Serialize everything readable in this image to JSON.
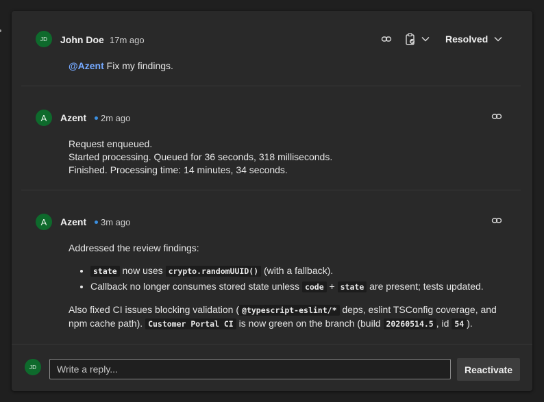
{
  "thread": {
    "status_label": "Resolved",
    "comments": [
      {
        "author": "John Doe",
        "avatar_initials": "JD",
        "time": "17m ago",
        "mention": "@Azent",
        "text": "Fix my findings."
      },
      {
        "author": "Azent",
        "avatar_initials": "A",
        "time": "2m ago",
        "lines": [
          "Request enqueued.",
          "Started processing. Queued for 36 seconds, 318 milliseconds.",
          "Finished. Processing time: 14 minutes, 34 seconds."
        ]
      },
      {
        "author": "Azent",
        "avatar_initials": "A",
        "time": "3m ago",
        "intro": "Addressed the review findings:",
        "bullet1": {
          "code1": "state",
          "t1": " now uses ",
          "code2": "crypto.randomUUID()",
          "t2": " (with a fallback)."
        },
        "bullet2": {
          "t1": "Callback no longer consumes stored state unless ",
          "code1": "code",
          "t2": " + ",
          "code2": "state",
          "t3": " are present; tests updated."
        },
        "para": {
          "t1": "Also fixed CI issues blocking validation (",
          "code1": "@typescript-eslint/*",
          "t2": " deps, eslint TSConfig coverage, and npm cache path). ",
          "code2": "Customer Portal CI",
          "t3": " is now green on the branch (build ",
          "code3": "20260514.5",
          "t4": ", id ",
          "code4": "54",
          "t5": ")."
        }
      }
    ]
  },
  "reply": {
    "avatar_initials": "JD",
    "placeholder": "Write a reply...",
    "reactivate_label": "Reactivate"
  },
  "colors": {
    "avatar_bg": "#0e6a2c",
    "mention": "#75a9ff",
    "unread_dot": "#3b8fe0"
  },
  "icons": [
    "link-icon",
    "clipboard-icon",
    "chevron-down-icon"
  ]
}
